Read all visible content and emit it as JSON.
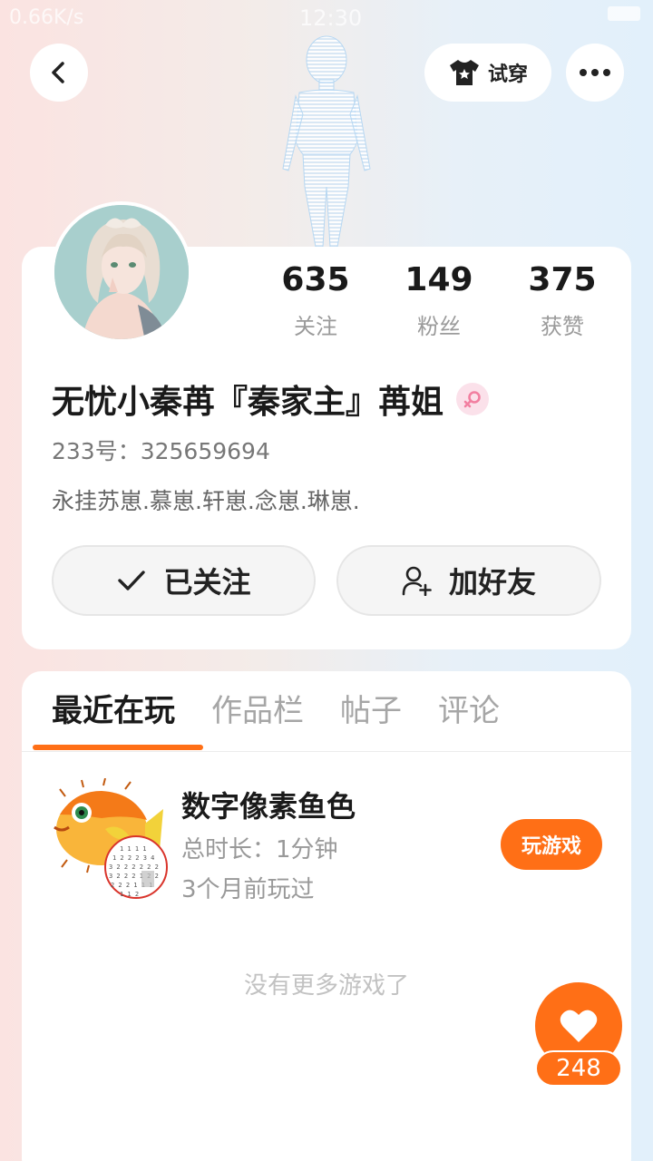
{
  "status_bar": {
    "speed": "0.66K/s",
    "time": "12:30"
  },
  "header": {
    "tryon_label": "试穿",
    "back_icon": "chevron-left-icon",
    "more_icon": "ellipsis-icon"
  },
  "profile": {
    "stats": [
      {
        "value": "635",
        "label": "关注"
      },
      {
        "value": "149",
        "label": "粉丝"
      },
      {
        "value": "375",
        "label": "获赞"
      }
    ],
    "username": "无忧小秦苒『秦家主』苒姐",
    "gender": "female",
    "uid": "233号：325659694",
    "bio": "永挂苏崽.慕崽.轩崽.念崽.琳崽.",
    "follow_label": "已关注",
    "add_friend_label": "加好友"
  },
  "tabs": [
    {
      "label": "最近在玩",
      "active": true
    },
    {
      "label": "作品栏",
      "active": false
    },
    {
      "label": "帖子",
      "active": false
    },
    {
      "label": "评论",
      "active": false
    }
  ],
  "games": [
    {
      "title": "数字像素鱼色",
      "duration": "总时长：1分钟",
      "last_played": "3个月前玩过",
      "play_label": "玩游戏"
    }
  ],
  "empty_text": "没有更多游戏了",
  "like": {
    "count": "248"
  },
  "colors": {
    "accent": "#ff6f16",
    "gender_badge_bg": "#fbe1ea",
    "gender_symbol": "#f27fa0"
  }
}
